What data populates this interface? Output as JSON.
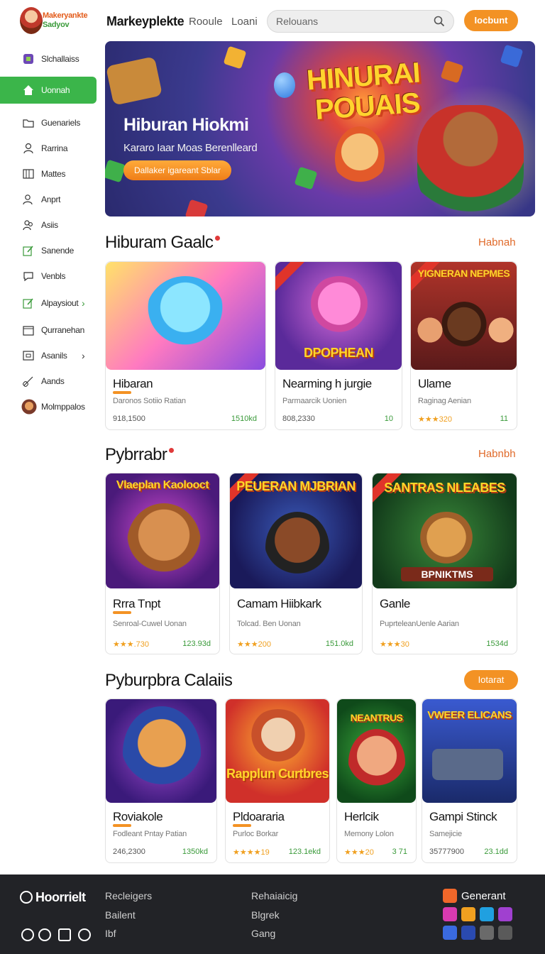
{
  "header": {
    "logo_line1": "Makeryankte",
    "logo_line2": "Sadyov",
    "brand": "Markeyplekte",
    "nav": [
      "Rooule",
      "Loani"
    ],
    "search_placeholder": "Relouans",
    "button": "Iocbunt"
  },
  "sidebar": {
    "items": [
      {
        "label": "Slchallaiss",
        "icon": "game-controller-icon"
      },
      {
        "label": "Uonnah",
        "icon": "home-icon",
        "active": true
      },
      {
        "label": "Guenariels",
        "icon": "folder-icon"
      },
      {
        "label": "Rarrina",
        "icon": "user-icon"
      },
      {
        "label": "Mattes",
        "icon": "grid-icon"
      },
      {
        "label": "Anprt",
        "icon": "users-icon"
      },
      {
        "label": "Asiis",
        "icon": "group-icon"
      },
      {
        "label": "Sanende",
        "icon": "edit-icon"
      },
      {
        "label": "Venbls",
        "icon": "chat-icon"
      },
      {
        "label": "Alpaysiout",
        "icon": "edit-icon",
        "chevron": true
      },
      {
        "label": "Qurranehan",
        "icon": "calendar-icon"
      },
      {
        "label": "Asanils",
        "icon": "box-icon",
        "chevron": true
      },
      {
        "label": "Aands",
        "icon": "link-icon"
      },
      {
        "label": "Molmppalos",
        "icon": "avatar-icon"
      }
    ]
  },
  "hero": {
    "big_title_line1": "HINURAI",
    "big_title_line2": "POUAIS",
    "title": "Hiburan Hiokmi",
    "subtitle": "Kararo Iaar Moas Berenlleard",
    "button": "Dallaker igareant Sblar"
  },
  "sections": [
    {
      "title": "Hiburam Gaalc",
      "link": "Habnah",
      "cards": [
        {
          "thumb_text": "",
          "name": "Hibaran",
          "desc": "Daronos Sotiio Ratian",
          "meta_l": "918,1500",
          "meta_r": "1510kd"
        },
        {
          "thumb_text": "DPOPHEAN",
          "name": "Nearming h jurgie",
          "desc": "Parmaarcik Uonien",
          "meta_l": "808,2330",
          "meta_r": "10"
        },
        {
          "thumb_text": "YIGNERAN NEPMES",
          "name": "Ulame",
          "desc": "Raginag Aenian",
          "meta_l": "★★★320",
          "meta_r": "11"
        }
      ]
    },
    {
      "title": "Pybrrabr",
      "link": "Habnbh",
      "cards": [
        {
          "thumb_text": "Vlaeplan Kaolooct",
          "name": "Rrra Tnpt",
          "desc": "Senroal-Cuwel Uonan",
          "meta_l": "★★★.730",
          "meta_r": "123.93d"
        },
        {
          "thumb_text": "PEUERAN MJBRIAN",
          "name": "Camam Hiibkark",
          "desc": "Tolcad. Ben Uonan",
          "meta_l": "★★★200",
          "meta_r": "151.0kd"
        },
        {
          "thumb_text": "SANTRAS NLEABES",
          "name": "Ganle",
          "desc": "PuprteleanUenle Aarian",
          "meta_l": "★★★30",
          "meta_r": "1534d"
        }
      ]
    },
    {
      "title": "Pyburpbra Calaiis",
      "button": "Iotarat",
      "cards": [
        {
          "thumb_text": "",
          "name": "Roviakole",
          "desc": "Fodleant Pntay Patian",
          "meta_l": "246,2300",
          "meta_r": "1350kd"
        },
        {
          "thumb_text": "Rapplun Curtbres",
          "name": "Pldoararia",
          "desc": "Purloc Borkar",
          "meta_l": "★★★★19",
          "meta_r": "123.1ekd"
        },
        {
          "thumb_text": "NEANTRUS",
          "name": "Herlcik",
          "desc": "Memony Lolon",
          "meta_l": "★★★20",
          "meta_r": "3 71"
        },
        {
          "thumb_text": "VWEER ELICANS",
          "name": "Gampi Stinck",
          "desc": "Samejicie",
          "meta_l": "35777900",
          "meta_r": "23.1dd"
        }
      ]
    }
  ],
  "footer": {
    "brand": "Hoorrielt",
    "col1": [
      "Recleigers",
      "Bailent",
      "Ibf"
    ],
    "col2": [
      "Rehaiaicig",
      "Blgrek",
      "Gang"
    ],
    "apps_label": "Generant"
  },
  "colors": {
    "accent_green": "#3bb54a",
    "accent_orange": "#f39224",
    "footer_bg": "#222327"
  }
}
